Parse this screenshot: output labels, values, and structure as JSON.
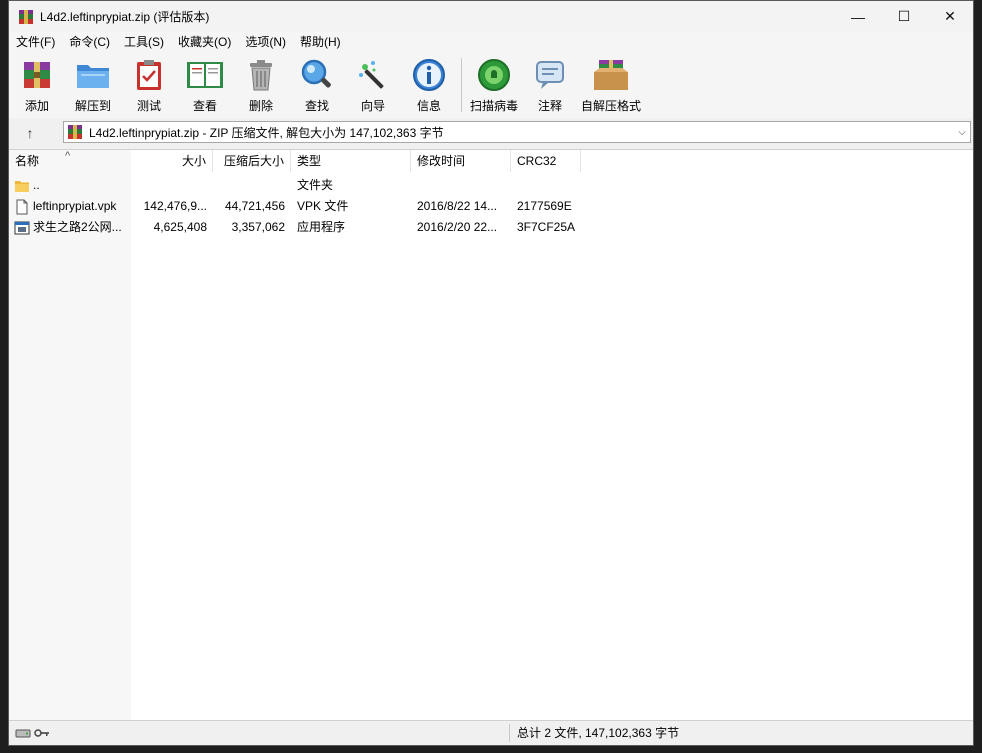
{
  "window": {
    "title": "L4d2.leftinprypiat.zip (评估版本)",
    "controls": {
      "minimize": "—",
      "maximize": "☐",
      "close": "✕"
    }
  },
  "menu": [
    "文件(F)",
    "命令(C)",
    "工具(S)",
    "收藏夹(O)",
    "选项(N)",
    "帮助(H)"
  ],
  "toolbar": [
    {
      "label": "添加",
      "icon": "add-archive-icon"
    },
    {
      "label": "解压到",
      "icon": "extract-to-folder-icon"
    },
    {
      "label": "测试",
      "icon": "test-clipboard-icon"
    },
    {
      "label": "查看",
      "icon": "view-book-icon"
    },
    {
      "label": "删除",
      "icon": "trash-icon"
    },
    {
      "label": "查找",
      "icon": "magnifier-icon"
    },
    {
      "label": "向导",
      "icon": "wizard-wand-icon"
    },
    {
      "label": "信息",
      "icon": "info-icon"
    },
    {
      "label": "扫描病毒",
      "icon": "virus-scan-icon"
    },
    {
      "label": "注释",
      "icon": "comment-icon"
    },
    {
      "label": "自解压格式",
      "icon": "sfx-box-icon"
    }
  ],
  "address": {
    "up_label": "↑",
    "text": "L4d2.leftinprypiat.zip - ZIP 压缩文件, 解包大小为 147,102,363 字节",
    "dropdown": "⌵"
  },
  "columns": [
    "名称",
    "大小",
    "压缩后大小",
    "类型",
    "修改时间",
    "CRC32"
  ],
  "sort_indicator": "^",
  "rows": [
    {
      "name": "..",
      "size": "",
      "packed": "",
      "type": "文件夹",
      "modified": "",
      "crc": "",
      "icon": "folder-icon"
    },
    {
      "name": "leftinprypiat.vpk",
      "size": "142,476,9...",
      "packed": "44,721,456",
      "type": "VPK 文件",
      "modified": "2016/8/22 14...",
      "crc": "2177569E",
      "icon": "file-icon"
    },
    {
      "name": "求生之路2公网...",
      "size": "4,625,408",
      "packed": "3,357,062",
      "type": "应用程序",
      "modified": "2016/2/20 22...",
      "crc": "3F7CF25A",
      "icon": "application-icon"
    }
  ],
  "status": {
    "summary": "总计 2 文件, 147,102,363 字节"
  },
  "colors": {
    "accent": "#1a6fd0",
    "listbg": "#ffffff",
    "chrome": "#f0f0f0"
  }
}
